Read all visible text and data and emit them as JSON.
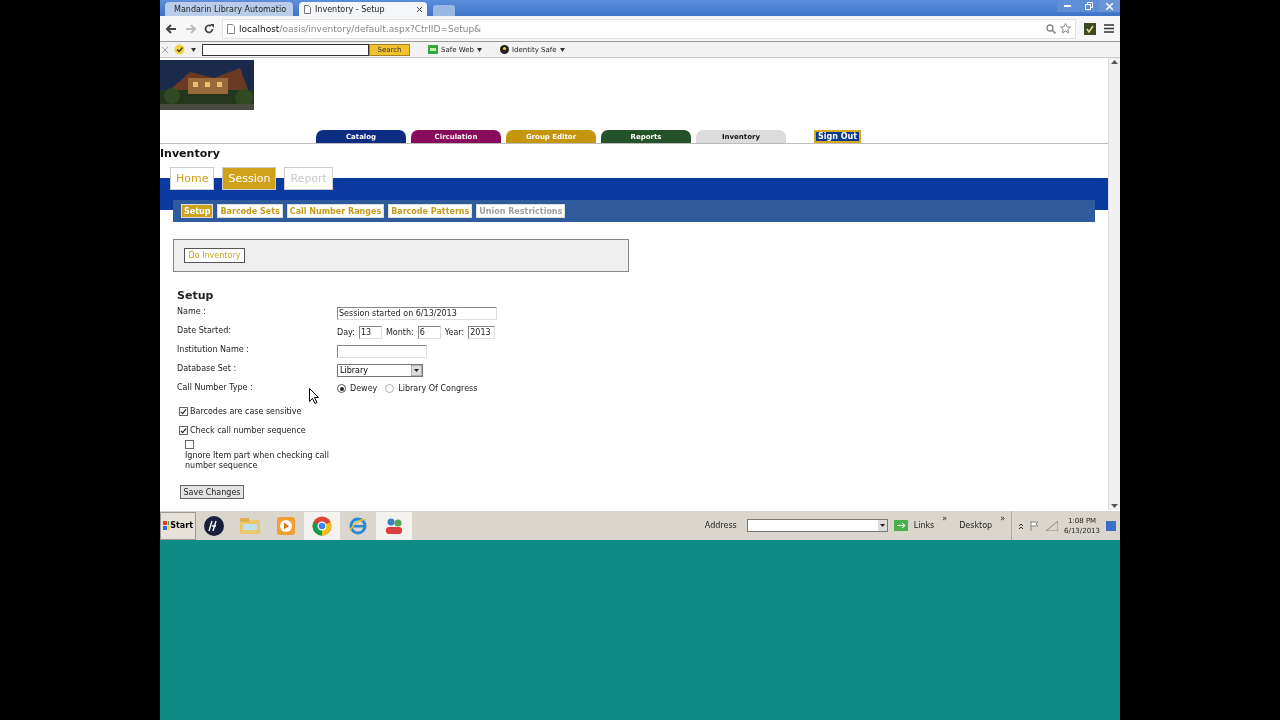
{
  "browser": {
    "tabs": [
      {
        "title": "Mandarin Library Automatio",
        "selected": false
      },
      {
        "title": "Inventory - Setup",
        "selected": true
      }
    ],
    "url_host": "localhost",
    "url_path": "/oasis/inventory/default.aspx?CtrlID=Setup&",
    "toolbar": {
      "search_button": "Search",
      "items": [
        "Safe Web",
        "Identity Safe"
      ]
    }
  },
  "main_nav": [
    {
      "label": "Catalog",
      "color": "#0d2d82",
      "selected": false
    },
    {
      "label": "Circulation",
      "color": "#8a0c5c",
      "selected": false
    },
    {
      "label": "Group Editor",
      "color": "#c3960e",
      "selected": false
    },
    {
      "label": "Reports",
      "color": "#24522a",
      "selected": false
    },
    {
      "label": "Inventory",
      "color": "#dcdcdc",
      "selected": true
    }
  ],
  "sign_out": "Sign Out",
  "page_title": "Inventory",
  "section_tabs": [
    {
      "label": "Home",
      "selected": false,
      "disabled": false
    },
    {
      "label": "Session",
      "selected": true,
      "disabled": false
    },
    {
      "label": "Report",
      "selected": false,
      "disabled": true
    }
  ],
  "sub_tabs": [
    {
      "label": "Setup",
      "selected": true,
      "disabled": false
    },
    {
      "label": "Barcode Sets",
      "selected": false,
      "disabled": false
    },
    {
      "label": "Call Number Ranges",
      "selected": false,
      "disabled": false
    },
    {
      "label": "Barcode Patterns",
      "selected": false,
      "disabled": false
    },
    {
      "label": "Union Restrictions",
      "selected": false,
      "disabled": true
    }
  ],
  "action_button": "Do Inventory",
  "form": {
    "title": "Setup",
    "name_label": "Name :",
    "name_value": "Session started on 6/13/2013",
    "date_label": "Date Started:",
    "day_label": "Day:",
    "day": "13",
    "month_label": "Month:",
    "month": "6",
    "year_label": "Year:",
    "year": "2013",
    "institution_label": "Institution Name :",
    "database_label": "Database Set :",
    "database_value": "Library",
    "call_number_label": "Call Number Type :",
    "call_number_options": [
      {
        "label": "Dewey",
        "selected": true
      },
      {
        "label": "Library Of Congress",
        "selected": false
      }
    ],
    "checkboxes": [
      {
        "label": "Barcodes are case sensitive",
        "checked": true
      },
      {
        "label": "Check call number sequence",
        "checked": true,
        "children": [
          {
            "label": "Ignore Item part when checking call number sequence",
            "checked": false
          }
        ]
      }
    ],
    "save_button": "Save Changes"
  },
  "taskbar": {
    "start": "Start",
    "address_label": "Address",
    "links": "Links",
    "links_more": "»",
    "desktop": "Desktop",
    "desktop_more": "»",
    "time": "1:08 PM",
    "date": "6/13/2013"
  }
}
